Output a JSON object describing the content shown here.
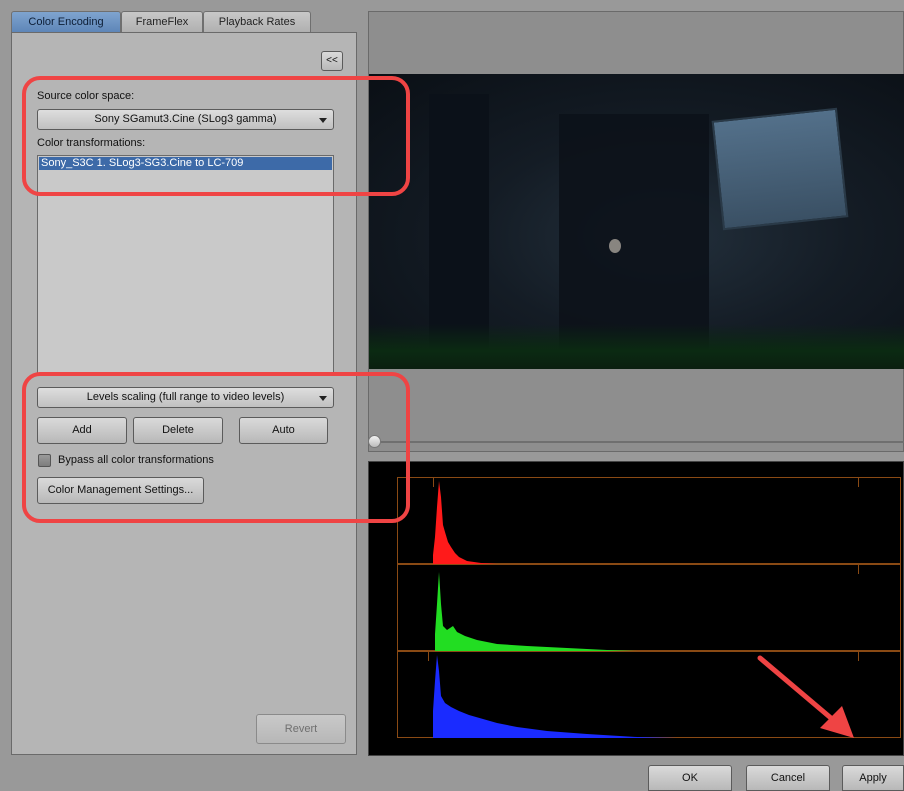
{
  "tabs": [
    {
      "label": "Color Encoding",
      "active": true
    },
    {
      "label": "FrameFlex",
      "active": false
    },
    {
      "label": "Playback Rates",
      "active": false
    }
  ],
  "panel": {
    "collapse_label": "<<",
    "source_label": "Source color space:",
    "source_value": "Sony SGamut3.Cine (SLog3 gamma)",
    "transformations_label": "Color transformations:",
    "transformations": [
      "Sony_S3C 1. SLog3-SG3.Cine to LC-709"
    ],
    "levels_value": "Levels scaling (full range to video levels)",
    "add_label": "Add",
    "delete_label": "Delete",
    "auto_label": "Auto",
    "bypass_label": "Bypass all color transformations",
    "bypass_checked": false,
    "settings_label": "Color Management Settings...",
    "revert_label": "Revert"
  },
  "footer": {
    "ok_label": "OK",
    "cancel_label": "Cancel",
    "apply_label": "Apply"
  },
  "colors": {
    "active_tab": "#6b8fc0",
    "annotation": "#ef4444",
    "histogram_red": "#ff1a1a",
    "histogram_green": "#22dd22",
    "histogram_blue": "#1a2bff"
  }
}
